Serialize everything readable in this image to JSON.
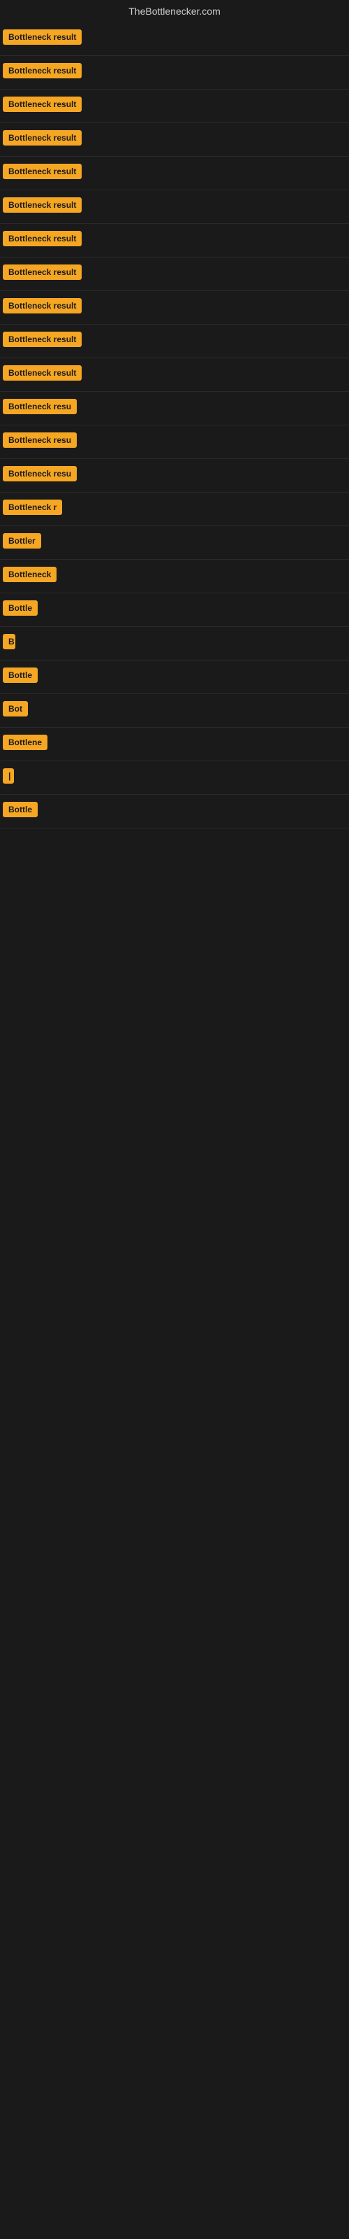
{
  "site": {
    "title": "TheBottlenecker.com"
  },
  "rows": [
    {
      "id": 1,
      "label": "Bottleneck result",
      "width": 160
    },
    {
      "id": 2,
      "label": "Bottleneck result",
      "width": 160
    },
    {
      "id": 3,
      "label": "Bottleneck result",
      "width": 160
    },
    {
      "id": 4,
      "label": "Bottleneck result",
      "width": 160
    },
    {
      "id": 5,
      "label": "Bottleneck result",
      "width": 160
    },
    {
      "id": 6,
      "label": "Bottleneck result",
      "width": 160
    },
    {
      "id": 7,
      "label": "Bottleneck result",
      "width": 160
    },
    {
      "id": 8,
      "label": "Bottleneck result",
      "width": 160
    },
    {
      "id": 9,
      "label": "Bottleneck result",
      "width": 160
    },
    {
      "id": 10,
      "label": "Bottleneck result",
      "width": 160
    },
    {
      "id": 11,
      "label": "Bottleneck result",
      "width": 160
    },
    {
      "id": 12,
      "label": "Bottleneck resu",
      "width": 130
    },
    {
      "id": 13,
      "label": "Bottleneck resu",
      "width": 125
    },
    {
      "id": 14,
      "label": "Bottleneck resu",
      "width": 120
    },
    {
      "id": 15,
      "label": "Bottleneck r",
      "width": 105
    },
    {
      "id": 16,
      "label": "Bottler",
      "width": 65
    },
    {
      "id": 17,
      "label": "Bottleneck",
      "width": 85
    },
    {
      "id": 18,
      "label": "Bottle",
      "width": 58
    },
    {
      "id": 19,
      "label": "B",
      "width": 18
    },
    {
      "id": 20,
      "label": "Bottle",
      "width": 58
    },
    {
      "id": 21,
      "label": "Bot",
      "width": 38
    },
    {
      "id": 22,
      "label": "Bottlene",
      "width": 72
    },
    {
      "id": 23,
      "label": "|",
      "width": 10
    },
    {
      "id": 24,
      "label": "Bottle",
      "width": 58
    }
  ]
}
